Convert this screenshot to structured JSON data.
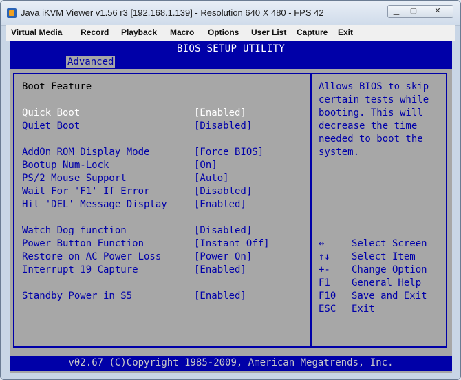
{
  "window": {
    "title": "Java iKVM Viewer v1.56 r3 [192.168.1.139] - Resolution 640 X 480 - FPS 42",
    "buttons": [
      "minimize-icon",
      "maximize-icon",
      "close-icon"
    ]
  },
  "menubar": {
    "items": [
      "Virtual Media",
      "Record",
      "Playback",
      "Macro",
      "Options",
      "User List",
      "Capture",
      "Exit"
    ]
  },
  "bios": {
    "title": "BIOS SETUP UTILITY",
    "active_tab": "Advanced",
    "section_title": "Boot Feature",
    "options": [
      {
        "label": "Quick Boot",
        "value": "[Enabled]",
        "selected": true
      },
      {
        "label": "Quiet Boot",
        "value": "[Disabled]",
        "selected": false
      },
      {
        "label": "AddOn ROM Display Mode",
        "value": "[Force BIOS]",
        "selected": false
      },
      {
        "label": "Bootup Num-Lock",
        "value": "[On]",
        "selected": false
      },
      {
        "label": "PS/2 Mouse Support",
        "value": "[Auto]",
        "selected": false
      },
      {
        "label": "Wait For 'F1' If Error",
        "value": "[Disabled]",
        "selected": false
      },
      {
        "label": "Hit 'DEL' Message Display",
        "value": "[Enabled]",
        "selected": false
      },
      {
        "label": "Watch Dog function",
        "value": "[Disabled]",
        "selected": false
      },
      {
        "label": "Power Button Function",
        "value": "[Instant Off]",
        "selected": false
      },
      {
        "label": "Restore on AC Power Loss",
        "value": "[Power On]",
        "selected": false
      },
      {
        "label": "Interrupt 19 Capture",
        "value": "[Enabled]",
        "selected": false
      },
      {
        "label": "Standby Power in S5",
        "value": "[Enabled]",
        "selected": false
      }
    ],
    "help_text": [
      "Allows BIOS to skip",
      "certain tests while",
      "booting. This will",
      "decrease the time",
      "needed to boot the",
      "system."
    ],
    "keys": [
      {
        "key": "↔",
        "desc": "Select Screen"
      },
      {
        "key": "↑↓",
        "desc": "Select Item"
      },
      {
        "key": "+-",
        "desc": "Change Option"
      },
      {
        "key": "F1",
        "desc": "General Help"
      },
      {
        "key": "F10",
        "desc": "Save and Exit"
      },
      {
        "key": "ESC",
        "desc": "Exit"
      }
    ],
    "footer": "v02.67 (C)Copyright 1985-2009, American Megatrends, Inc.",
    "colors": {
      "background": "#a7a7a7",
      "blue": "#0000a8",
      "highlight": "#ffffff"
    }
  }
}
